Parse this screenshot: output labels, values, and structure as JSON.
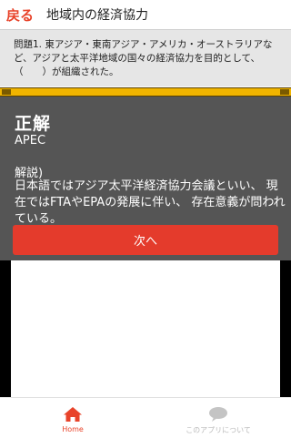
{
  "header": {
    "back_label": "戻る",
    "title": "地域内の経済協力"
  },
  "question": {
    "text": "問題1. 東アジア・東南アジア・アメリカ・オーストラリアなど、アジアと太平洋地域の国々の経済協力を目的として、（　　）が組織された。"
  },
  "answer": {
    "heading": "正解",
    "value": "APEC",
    "explanation_label": "解説)",
    "explanation": "日本語ではアジア太平洋経済協力会議といい、 現在ではFTAやEPAの発展に伴い、 存在意義が問われている。"
  },
  "next_button": {
    "label": "次へ"
  },
  "tabbar": {
    "home_label": "Home",
    "about_label": "このアプリについて",
    "home_icon": "home-icon",
    "about_icon": "speech-bubble-icon"
  },
  "colors": {
    "accent": "#e8432a",
    "button": "#e43b2c",
    "progress": "#f0b400",
    "overlay": "#555555",
    "question_bg": "#e6e6e6"
  }
}
